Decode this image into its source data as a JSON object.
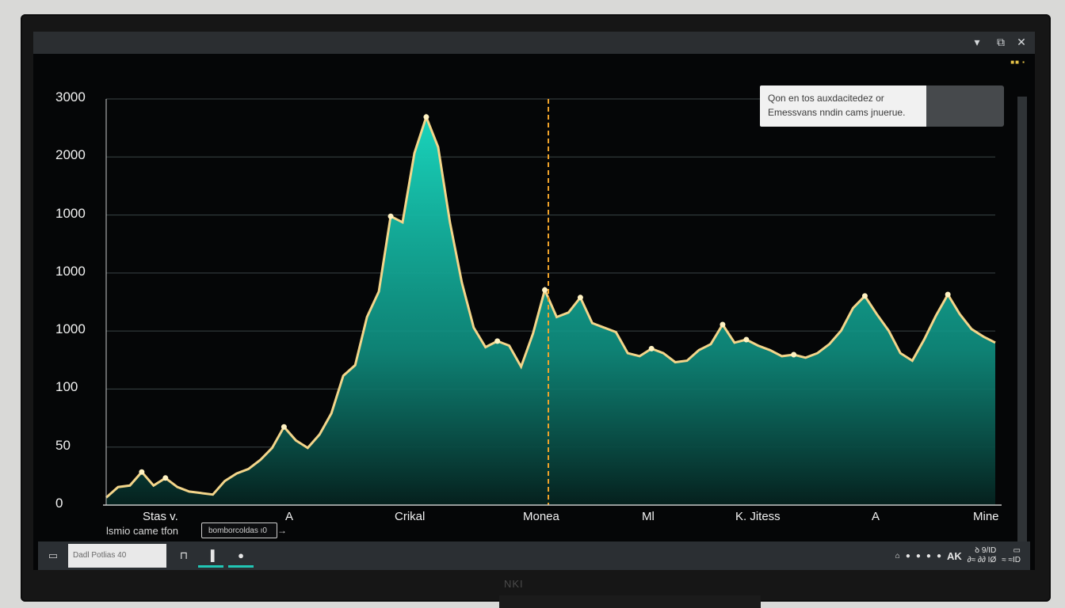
{
  "window": {
    "minimize_icon": "chevron-down-icon",
    "restore_icon": "window-icon",
    "close_icon": "close-icon",
    "minimize_glyph": "▾",
    "restore_glyph": "⧉",
    "close_glyph": "✕"
  },
  "tooltip": {
    "line1": "Qon en tos auxdacitedez or",
    "line2": "Emessvans nndin cams jnuerue."
  },
  "sub_label": "lsmio came tfon",
  "sub_field": "bomborcoldas ı0",
  "sub_arrow": "→",
  "taskbar": {
    "start_glyph": "▭",
    "search_text": "Dadl Potlias 40",
    "buttons": [
      {
        "glyph": "⊓",
        "active": false
      },
      {
        "glyph": "▐",
        "active": true
      },
      {
        "glyph": "●",
        "active": true
      }
    ],
    "tray_icons": [
      "⌂",
      "●",
      "●",
      "●",
      "●"
    ],
    "tray_big": "AK",
    "clock_time": "ꝺ 9/ID",
    "clock_date": "∂≈ ∂∂ IØ",
    "notify_glyph": "▭",
    "notify_text": "≈ ≈ID"
  },
  "monitor_logo": "NKI",
  "chart_data": {
    "type": "area",
    "y_tick_labels": [
      "3000",
      "2000",
      "1000",
      "1000",
      "1000",
      "100",
      "50",
      "0"
    ],
    "x_tick_labels": [
      "Stas v.",
      "A",
      "Crikal",
      "Monea",
      "Ml",
      "K. Jitess",
      "A",
      "Mine"
    ],
    "marker_label": "Monea",
    "values": [
      50,
      120,
      130,
      220,
      130,
      180,
      120,
      90,
      80,
      70,
      160,
      210,
      240,
      300,
      380,
      520,
      430,
      380,
      470,
      610,
      860,
      930,
      1250,
      1420,
      1920,
      1880,
      2340,
      2580,
      2380,
      1880,
      1480,
      1180,
      1050,
      1090,
      1060,
      920,
      1140,
      1430,
      1250,
      1280,
      1380,
      1210,
      1180,
      1150,
      1010,
      990,
      1040,
      1010,
      950,
      960,
      1030,
      1070,
      1200,
      1080,
      1100,
      1060,
      1030,
      990,
      1000,
      980,
      1010,
      1070,
      1160,
      1310,
      1390,
      1270,
      1160,
      1010,
      960,
      1100,
      1260,
      1400,
      1270,
      1170,
      1120,
      1080
    ],
    "line_color": "#f3d58a",
    "fill_color": "#16c3ad",
    "marker_color": "#f0a32a",
    "grid": true,
    "legend": "none"
  }
}
